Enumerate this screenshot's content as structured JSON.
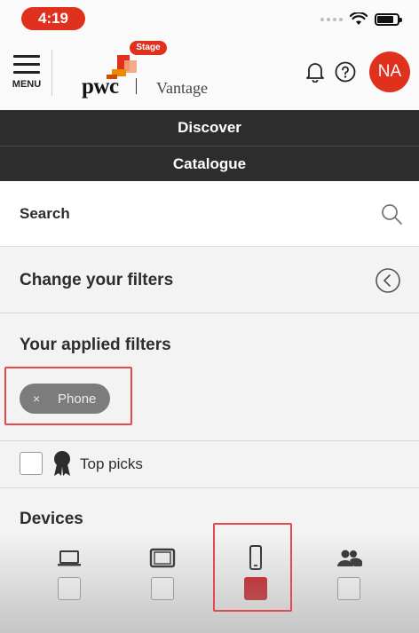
{
  "status_bar": {
    "time": "4:19"
  },
  "header": {
    "menu_label": "MENU",
    "logo": {
      "brand": "pwc",
      "product": "Vantage",
      "badge": "Stage"
    },
    "avatar_initials": "NA"
  },
  "nav": {
    "discover": "Discover",
    "catalogue": "Catalogue"
  },
  "search": {
    "placeholder": "Search"
  },
  "filters": {
    "change_label": "Change your filters",
    "applied_heading": "Your applied filters",
    "applied": [
      {
        "label": "Phone",
        "remove_symbol": "×"
      }
    ],
    "top_picks": {
      "label": "Top picks",
      "checked": false
    }
  },
  "devices": {
    "heading": "Devices",
    "options": [
      {
        "icon": "laptop-icon",
        "checked": false
      },
      {
        "icon": "tablet-icon",
        "checked": false
      },
      {
        "icon": "phone-icon",
        "checked": true
      },
      {
        "icon": "people-icon",
        "checked": false
      }
    ]
  },
  "colors": {
    "brand": "#e0301e",
    "dark_bar": "#2d2d2d",
    "chip": "#7c7c7c",
    "checked": "#c8181e",
    "highlight": "#e5484d"
  }
}
